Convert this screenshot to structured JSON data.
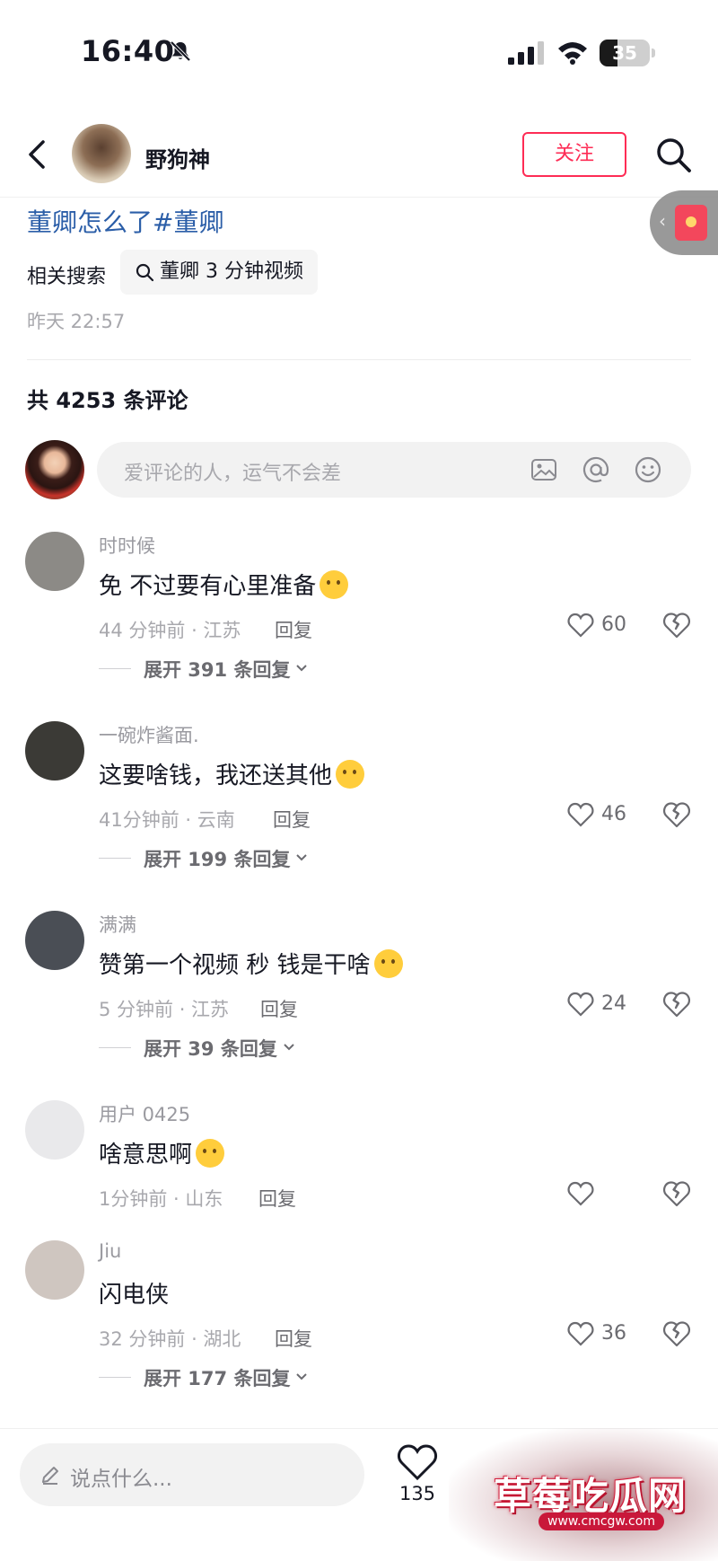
{
  "status_bar": {
    "time": "16:40",
    "battery": "35",
    "battery_fraction": 0.35
  },
  "header": {
    "author_name": "野狗神",
    "follow_label": "关注"
  },
  "post": {
    "caption": "董卿怎么了#董卿",
    "related_label": "相关搜索",
    "related_query": "董卿 3 分钟视频",
    "timestamp": "昨天 22:57"
  },
  "comments_header": {
    "count_text": "共 4253 条评论"
  },
  "comment_input": {
    "placeholder": "爱评论的人，运气不会差"
  },
  "reply_label": "回复",
  "comments": [
    {
      "user": "时时候",
      "text": "免 不过要有心里准备",
      "emoji": "yum-face-emoji",
      "time": "44 分钟前 · 江苏",
      "likes": "60",
      "expand": "展开 391 条回复",
      "avatar_color": "#8c8a86"
    },
    {
      "user": "一碗炸酱面.",
      "text": "这要啥钱，我还送其他",
      "emoji": "laughing-crying-emoji",
      "time": "41分钟前 · 云南",
      "likes": "46",
      "expand": "展开 199 条回复",
      "avatar_color": "#3b3a36"
    },
    {
      "user": "满满",
      "text": "赞第一个视频 秒  钱是干啥",
      "emoji": "thinking-face-emoji",
      "time": "5 分钟前 · 江苏",
      "likes": "24",
      "expand": "展开 39 条回复",
      "avatar_color": "#4a4e55"
    },
    {
      "user": "用户 0425",
      "text": "啥意思啊",
      "emoji": "pleading-face-emoji",
      "time": "1分钟前 · 山东",
      "likes": "",
      "expand": "",
      "avatar_color": "#e9e9eb"
    },
    {
      "user": "Jiu",
      "text": "闪电侠",
      "emoji": "",
      "time": "32 分钟前 · 湖北",
      "likes": "36",
      "expand": "展开 177 条回复",
      "avatar_color": "#cfc6c0"
    }
  ],
  "bottom_bar": {
    "placeholder": "说点什么...",
    "likes": "135"
  },
  "watermark": {
    "title": "草莓吃瓜网",
    "url": "www.cmcgw.com"
  },
  "colors": {
    "accent_red": "#fe2c55",
    "hashtag_blue": "#2b5ea8",
    "secondary_text": "#a8a8ad"
  }
}
